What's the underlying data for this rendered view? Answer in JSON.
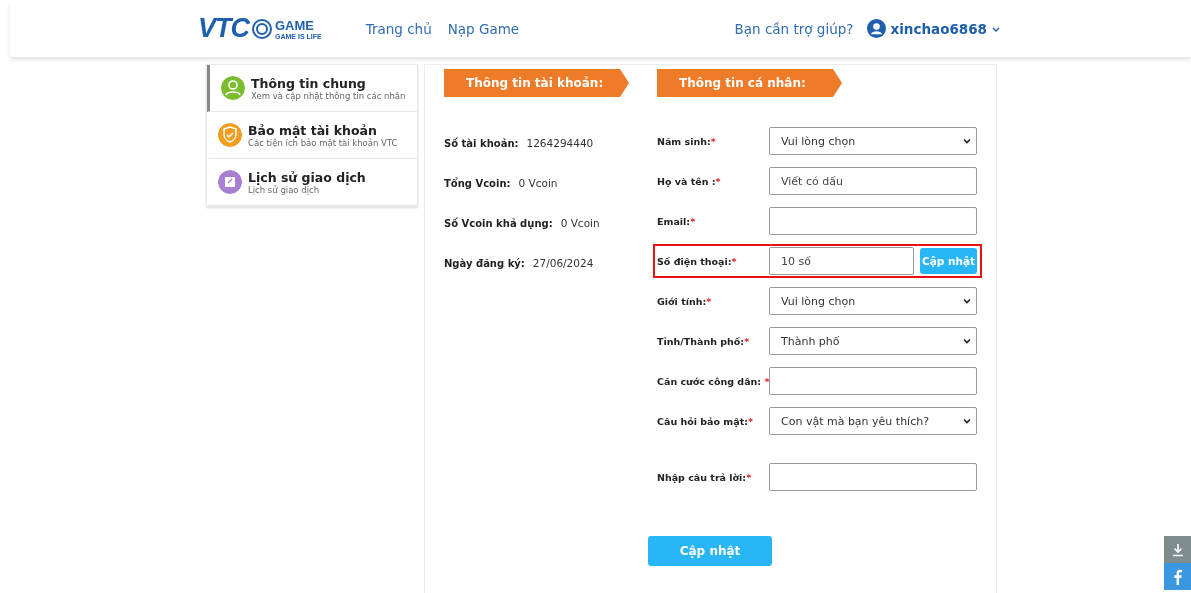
{
  "header": {
    "logo": {
      "main": "VTC",
      "game": "GAME",
      "tagline": "GAME IS LIFE"
    },
    "nav": [
      {
        "label": "Trang chủ"
      },
      {
        "label": "Nạp Game"
      }
    ],
    "help": "Bạn cần trợ giúp?",
    "user": "xinchao6868"
  },
  "sidebar": {
    "items": [
      {
        "title": "Thông tin chung",
        "subtitle": "Xem và cập nhật thông tin các nhân",
        "selected": true,
        "color": "#7cbd2f",
        "kind": "user"
      },
      {
        "title": "Bảo mật tài khoản",
        "subtitle": "Các tiện ích bảo mật tài khoản VTC",
        "selected": false,
        "color": "#f39c1e",
        "kind": "shield"
      },
      {
        "title": "Lịch sử giao dịch",
        "subtitle": "Lịch sử giao dịch",
        "selected": false,
        "color": "#a97fd4",
        "kind": "edit"
      }
    ]
  },
  "account": {
    "heading": "Thông tin tài khoản:",
    "rows": [
      {
        "label": "Số tài khoản:",
        "value": "1264294440"
      },
      {
        "label": "Tổng Vcoin:",
        "value": "0 Vcoin"
      },
      {
        "label": "Số Vcoin khả dụng:",
        "value": "0 Vcoin"
      },
      {
        "label": "Ngày đăng ký:",
        "value": "27/06/2024"
      }
    ]
  },
  "personal": {
    "heading": "Thông tin cá nhân:",
    "fields": [
      {
        "label": "Năm sinh:",
        "kind": "select",
        "value": "Vui lòng chọn"
      },
      {
        "label": "Họ và tên :",
        "kind": "input",
        "placeholder": "Viết có dấu"
      },
      {
        "label": "Email:",
        "kind": "input"
      },
      {
        "label": "Số điện thoại:",
        "kind": "input",
        "placeholder": "10 số",
        "highlighted": true,
        "button": "Cập nhật"
      },
      {
        "label": "Giới tính:",
        "kind": "select",
        "value": "Vui lòng chọn"
      },
      {
        "label": "Tỉnh/Thành phố:",
        "kind": "select",
        "value": "Thành phố"
      },
      {
        "label": "Căn cước công dân: ",
        "kind": "input"
      },
      {
        "label": "Câu hỏi bảo mật:",
        "kind": "select",
        "value": "Con vật mà bạn yêu thích?"
      },
      {
        "label": "Nhập câu trả lời:",
        "kind": "input"
      }
    ],
    "required_mark": "*",
    "submit": "Cập nhật"
  }
}
